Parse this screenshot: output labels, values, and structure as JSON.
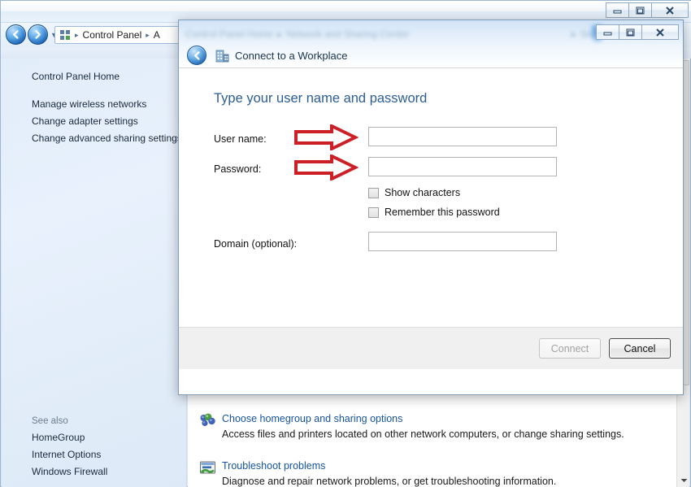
{
  "explorer": {
    "window_controls": [
      {
        "name": "minimize",
        "glyph": "minimize-icon"
      },
      {
        "name": "maximize",
        "glyph": "maximize-icon"
      },
      {
        "name": "close",
        "glyph": "close-icon"
      }
    ],
    "address_bar": {
      "root_icon": "control-panel-icon",
      "crumbs": [
        "Control Panel",
        "A"
      ],
      "separator": "▸"
    },
    "sidebar": {
      "home_label": "Control Panel Home",
      "tasks": [
        "Manage wireless networks",
        "Change adapter settings",
        "Change advanced sharing settings"
      ],
      "see_also_header": "See also",
      "see_also": [
        "HomeGroup",
        "Internet Options",
        "Windows Firewall"
      ]
    },
    "content_items": [
      {
        "icon": "homegroup-icon",
        "link": "Choose homegroup and sharing options",
        "description": "Access files and printers located on other network computers, or change sharing settings."
      },
      {
        "icon": "troubleshoot-icon",
        "link": "Troubleshoot problems",
        "description": "Diagnose and repair network problems, or get troubleshooting information."
      }
    ],
    "scrollbar": {
      "down_arrow": "chevron-down-icon"
    }
  },
  "dialog": {
    "ghost_breadcrumbs": [
      "Control Panel Home",
      "▸",
      "Network and Sharing Center",
      "▸",
      "Search Control Panel"
    ],
    "window_controls": [
      {
        "name": "minimize",
        "glyph": "minimize-icon"
      },
      {
        "name": "maximize",
        "glyph": "maximize-icon"
      },
      {
        "name": "close",
        "glyph": "close-icon"
      }
    ],
    "back_button": "back-arrow-icon",
    "app_icon": "workplace-building-icon",
    "title": "Connect to a Workplace",
    "heading": "Type your user name and password",
    "fields": [
      {
        "label": "User name:",
        "value": "",
        "placeholder": "",
        "name": "username"
      },
      {
        "label": "Password:",
        "value": "",
        "placeholder": "",
        "name": "password"
      },
      {
        "label": "Domain (optional):",
        "value": "",
        "placeholder": "",
        "name": "domain"
      }
    ],
    "checkboxes": [
      {
        "label": "Show characters",
        "checked": false,
        "name": "show-characters"
      },
      {
        "label": "Remember this password",
        "checked": false,
        "name": "remember-password"
      }
    ],
    "buttons": {
      "connect": {
        "label": "Connect",
        "enabled": false
      },
      "cancel": {
        "label": "Cancel",
        "enabled": true,
        "default": true
      }
    },
    "annotations": [
      {
        "type": "red-arrow",
        "points_to": "username-input"
      },
      {
        "type": "red-arrow",
        "points_to": "password-input"
      }
    ]
  },
  "colors": {
    "accent_blue": "#2c5d93",
    "link_blue": "#15539e",
    "annotation_red": "#cc2026",
    "window_chrome": "#dfeaf8"
  }
}
